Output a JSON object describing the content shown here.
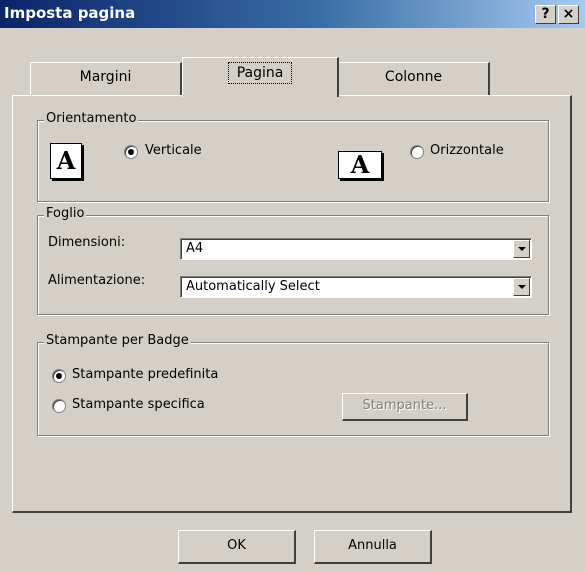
{
  "window": {
    "title": "Imposta pagina",
    "help_button": "?",
    "close_button": "×"
  },
  "tabs": [
    {
      "label": "Margini",
      "active": false
    },
    {
      "label": "Pagina",
      "active": true
    },
    {
      "label": "Colonne",
      "active": false
    }
  ],
  "orientation": {
    "legend": "Orientamento",
    "icon_glyph": "A",
    "portrait": {
      "label": "Verticale",
      "selected": true
    },
    "landscape": {
      "label": "Orizzontale",
      "selected": false
    }
  },
  "sheet": {
    "legend": "Foglio",
    "size_label": "Dimensioni:",
    "size_value": "A4",
    "source_label": "Alimentazione:",
    "source_value": "Automatically Select"
  },
  "badge_printer": {
    "legend": "Stampante per Badge",
    "default_option": {
      "label": "Stampante predefinita",
      "selected": true
    },
    "specific_option": {
      "label": "Stampante specifica",
      "selected": false
    },
    "printer_button": "Stampante...",
    "printer_button_enabled": false
  },
  "footer": {
    "ok": "OK",
    "cancel": "Annulla"
  }
}
